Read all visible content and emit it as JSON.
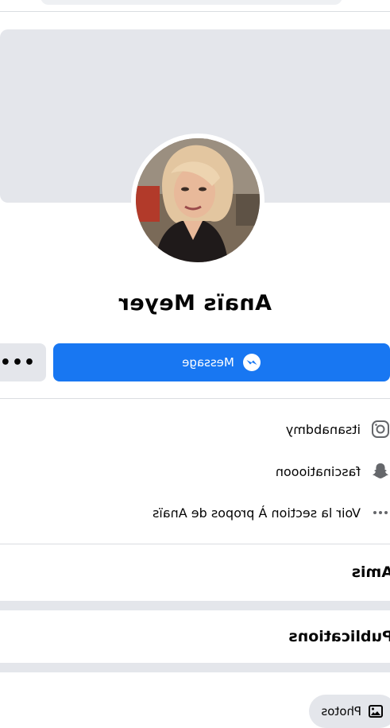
{
  "profile": {
    "name": "Anaïs Meyer",
    "message_label": "Message",
    "more_label": "•••"
  },
  "about": {
    "items": [
      {
        "icon": "instagram-icon",
        "text": "itsanabdmy"
      },
      {
        "icon": "snapchat-icon",
        "text": "fascinatiooon"
      },
      {
        "icon": "more-dots-icon",
        "text": "Voir la section À propos de Anaïs"
      }
    ]
  },
  "sections": {
    "friends_title": "Amis",
    "posts_title": "Publications"
  },
  "filters": {
    "photos_label": "Photos"
  },
  "colors": {
    "primary": "#1877f2",
    "cover": "#e4e6eb",
    "divider": "#dadde1"
  }
}
